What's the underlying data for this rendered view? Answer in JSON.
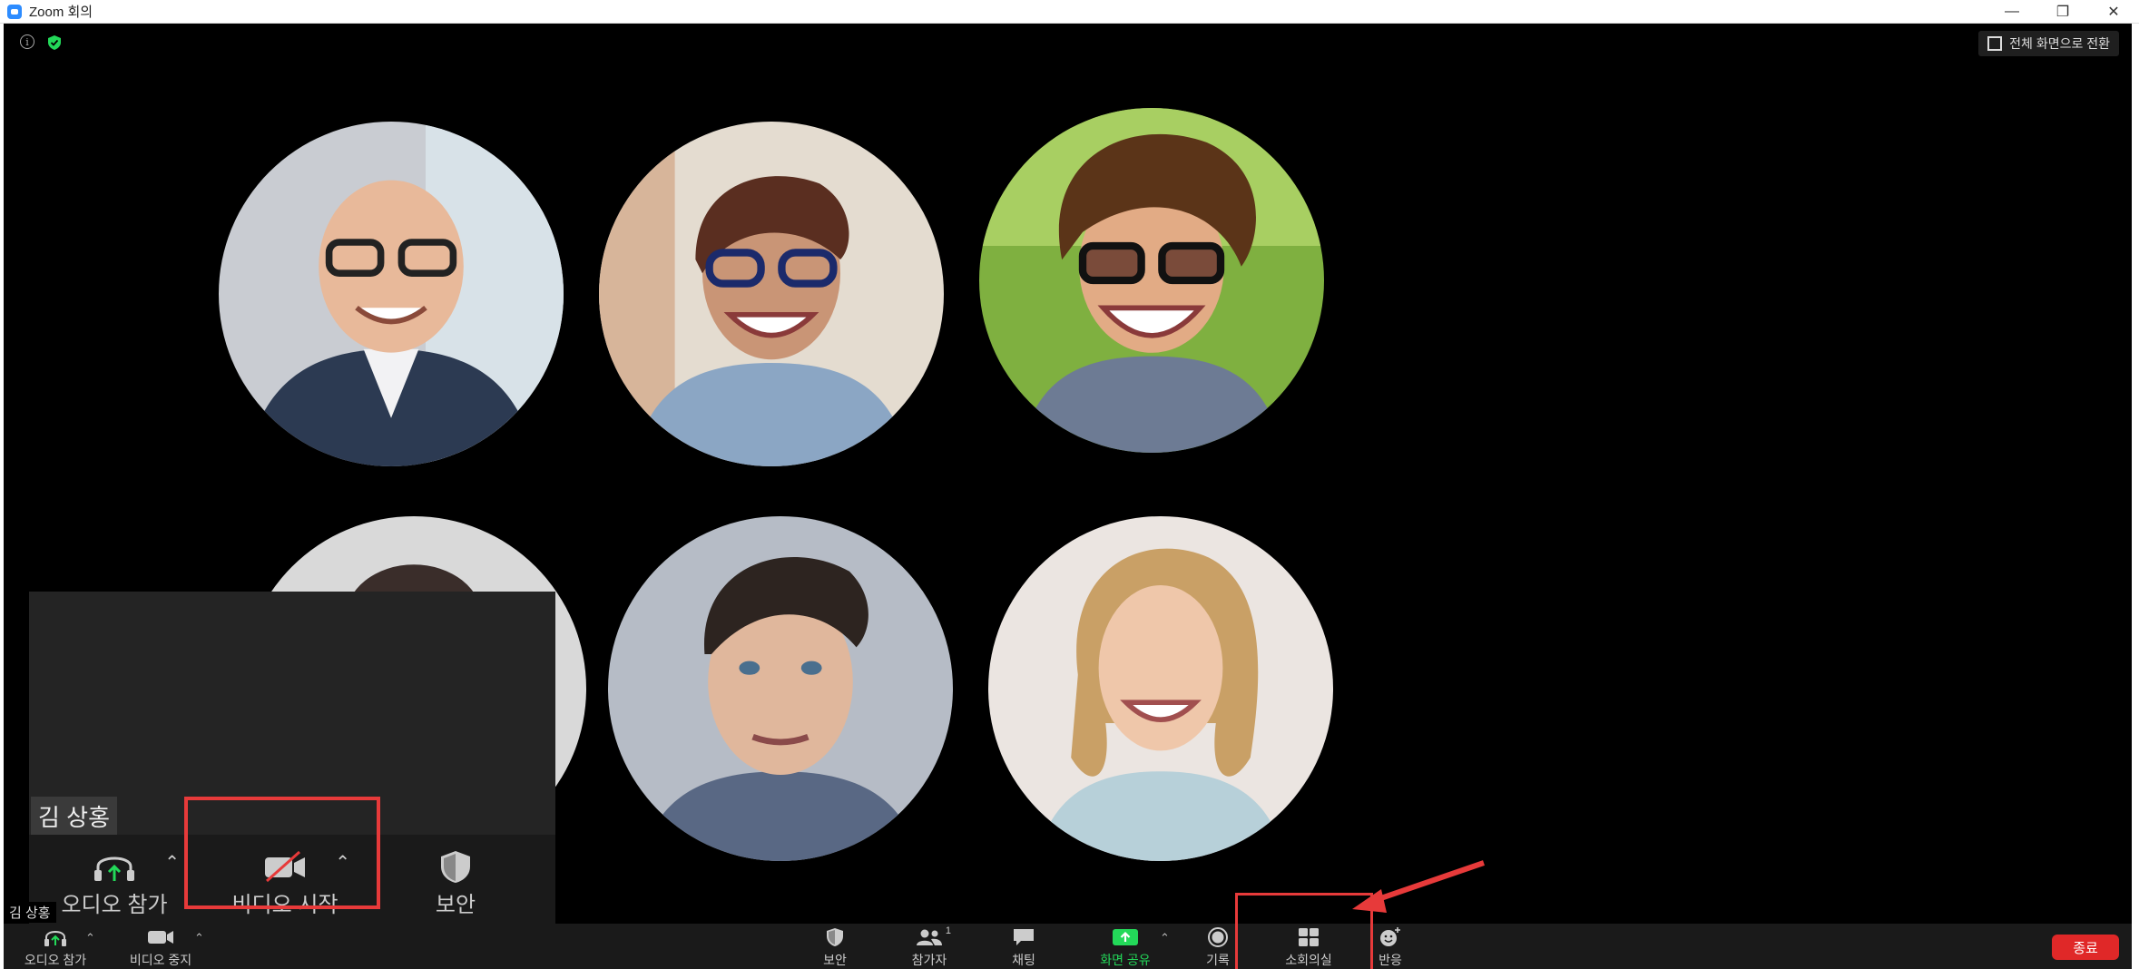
{
  "window": {
    "title": "Zoom 회의",
    "minimize": "—",
    "restore": "❐",
    "close": "✕"
  },
  "stage": {
    "fullscreen_label": "전체 화면으로 전환"
  },
  "self_view": {
    "name": "김 상홍",
    "audio_label": "오디오 참가",
    "video_label": "비디오 시작",
    "security_label": "보안"
  },
  "bottom_name": "김 상홍",
  "toolbar": {
    "audio": "오디오 참가",
    "video": "비디오 중지",
    "security": "보안",
    "participants": "참가자",
    "participants_count": "1",
    "chat": "채팅",
    "share": "화면 공유",
    "record": "기록",
    "breakout": "소회의실",
    "reactions": "반응",
    "end": "종료"
  },
  "colors": {
    "accent_green": "#23d959",
    "end_red": "#e02828",
    "highlight": "#e73a3a"
  }
}
